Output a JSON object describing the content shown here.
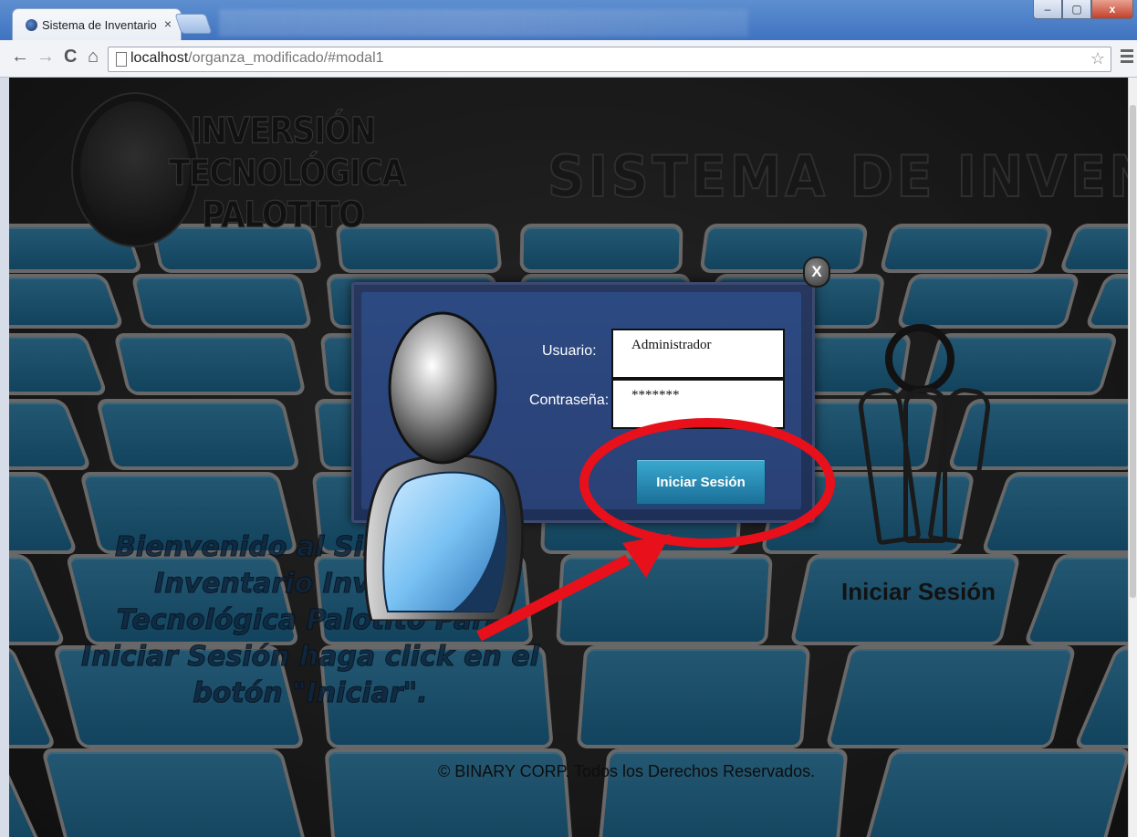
{
  "browser": {
    "tab_title": "Sistema de Inventario",
    "tab_close": "×",
    "url_host": "localhost",
    "url_path": "/organza_modificado/#modal1",
    "back_icon": "←",
    "forward_icon": "→",
    "reload_icon": "C",
    "home_icon": "⌂",
    "star_icon": "☆",
    "win_min": "–",
    "win_max": "▢",
    "win_close": "x"
  },
  "page": {
    "logo_text": "INVERSIÓN TECNOLÓGICA PALOTITO",
    "site_title": "SISTEMA DE INVENTARIO",
    "welcome_text": "Bienvenido al Sistema de Inventario Inversión Tecnológica Palotito Para Iniciar Sesión haga click en el botón \"Iniciar\".",
    "key_label": "Iniciar Sesión",
    "footer": "© BINARY CORP. Todos los Derechos Reservados."
  },
  "modal": {
    "close_label": "X",
    "username_label": "Usuario:",
    "username_value": "Administrador",
    "password_label": "Contraseña:",
    "password_value": "*******",
    "login_button": "Iniciar Sesión"
  },
  "colors": {
    "annotation": "#e8101a",
    "tile_fill": "#2a82b0",
    "button": "#2a8fbc"
  }
}
